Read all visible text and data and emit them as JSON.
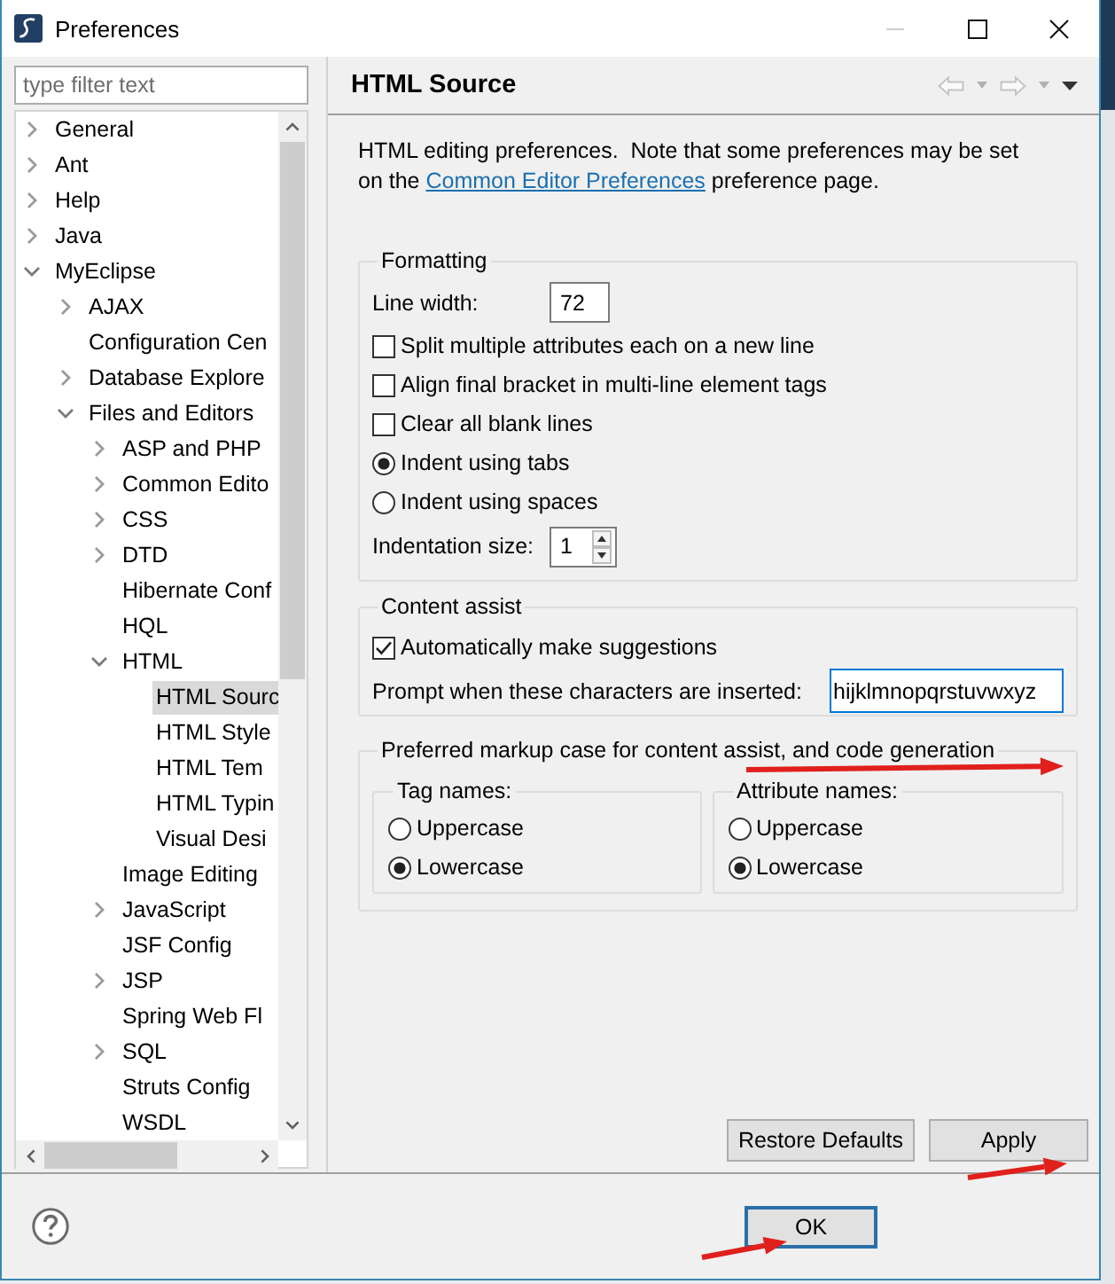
{
  "window": {
    "title": "Preferences"
  },
  "filter": {
    "placeholder": "type filter text"
  },
  "tree": [
    {
      "kind": "branch",
      "label": "General",
      "expanded": false,
      "selected": false
    },
    {
      "kind": "branch",
      "label": "Ant",
      "expanded": false,
      "selected": false
    },
    {
      "kind": "branch",
      "label": "Help",
      "expanded": false,
      "selected": false
    },
    {
      "kind": "branch",
      "label": "Java",
      "expanded": false,
      "selected": false
    },
    {
      "kind": "branch",
      "label": "MyEclipse",
      "expanded": true,
      "selected": false,
      "children": [
        {
          "kind": "branch",
          "label": "AJAX",
          "expanded": false,
          "selected": false
        },
        {
          "kind": "leaf",
          "label": "Configuration Cen",
          "selected": false
        },
        {
          "kind": "branch",
          "label": "Database Explore",
          "expanded": false,
          "selected": false
        },
        {
          "kind": "branch",
          "label": "Files and Editors",
          "expanded": true,
          "selected": false,
          "children": [
            {
              "kind": "branch",
              "label": "ASP and PHP",
              "expanded": false,
              "selected": false
            },
            {
              "kind": "branch",
              "label": "Common Edito",
              "expanded": false,
              "selected": false
            },
            {
              "kind": "branch",
              "label": "CSS",
              "expanded": false,
              "selected": false
            },
            {
              "kind": "branch",
              "label": "DTD",
              "expanded": false,
              "selected": false
            },
            {
              "kind": "leaf",
              "label": "Hibernate Conf",
              "selected": false
            },
            {
              "kind": "leaf",
              "label": "HQL",
              "selected": false
            },
            {
              "kind": "branch",
              "label": "HTML",
              "expanded": true,
              "selected": false,
              "children": [
                {
                  "kind": "leaf",
                  "label": "HTML Sourc",
                  "selected": true
                },
                {
                  "kind": "leaf",
                  "label": "HTML Style",
                  "selected": false
                },
                {
                  "kind": "leaf",
                  "label": "HTML Tem",
                  "selected": false
                },
                {
                  "kind": "leaf",
                  "label": "HTML Typin",
                  "selected": false
                },
                {
                  "kind": "leaf",
                  "label": "Visual Desi",
                  "selected": false
                }
              ]
            },
            {
              "kind": "leaf",
              "label": "Image Editing",
              "selected": false
            },
            {
              "kind": "branch",
              "label": "JavaScript",
              "expanded": false,
              "selected": false
            },
            {
              "kind": "leaf",
              "label": "JSF Config",
              "selected": false
            },
            {
              "kind": "branch",
              "label": "JSP",
              "expanded": false,
              "selected": false
            },
            {
              "kind": "leaf",
              "label": "Spring Web Fl",
              "selected": false
            },
            {
              "kind": "branch",
              "label": "SQL",
              "expanded": false,
              "selected": false
            },
            {
              "kind": "leaf",
              "label": "Struts Config",
              "selected": false
            },
            {
              "kind": "leaf",
              "label": "WSDL",
              "selected": false
            }
          ]
        }
      ]
    }
  ],
  "page": {
    "title": "HTML Source",
    "description": {
      "before": "HTML editing preferences.  Note that some preferences may be set on the ",
      "link": "Common Editor Preferences",
      "after": " preference page."
    }
  },
  "formatting": {
    "legend": "Formatting",
    "line_width": {
      "label": "Line width:",
      "value": "72"
    },
    "options": [
      {
        "kind": "checkbox",
        "label": "Split multiple attributes each on a new line",
        "checked": false
      },
      {
        "kind": "checkbox",
        "label": "Align final bracket in multi-line element tags",
        "checked": false
      },
      {
        "kind": "checkbox",
        "label": "Clear all blank lines",
        "checked": false
      },
      {
        "kind": "radio",
        "label": "Indent using tabs",
        "selected": true
      },
      {
        "kind": "radio",
        "label": "Indent using spaces",
        "selected": false
      }
    ],
    "indentation_size": {
      "label": "Indentation size:",
      "value": "1"
    }
  },
  "content_assist": {
    "legend": "Content assist",
    "auto_suggest": {
      "label": "Automatically make suggestions",
      "checked": true
    },
    "prompt": {
      "label": "Prompt when these characters are inserted:",
      "value": "hijklmnopqrstuvwxyz"
    }
  },
  "markup_case": {
    "legend": "Preferred markup case for content assist, and code generation",
    "groups": [
      {
        "legend": "Tag names:",
        "options": [
          {
            "label": "Uppercase",
            "selected": false
          },
          {
            "label": "Lowercase",
            "selected": true
          }
        ]
      },
      {
        "legend": "Attribute names:",
        "options": [
          {
            "label": "Uppercase",
            "selected": false
          },
          {
            "label": "Lowercase",
            "selected": true
          }
        ]
      }
    ]
  },
  "page_buttons": [
    "Restore Defaults",
    "Apply"
  ],
  "dialog_buttons": [
    "OK"
  ]
}
